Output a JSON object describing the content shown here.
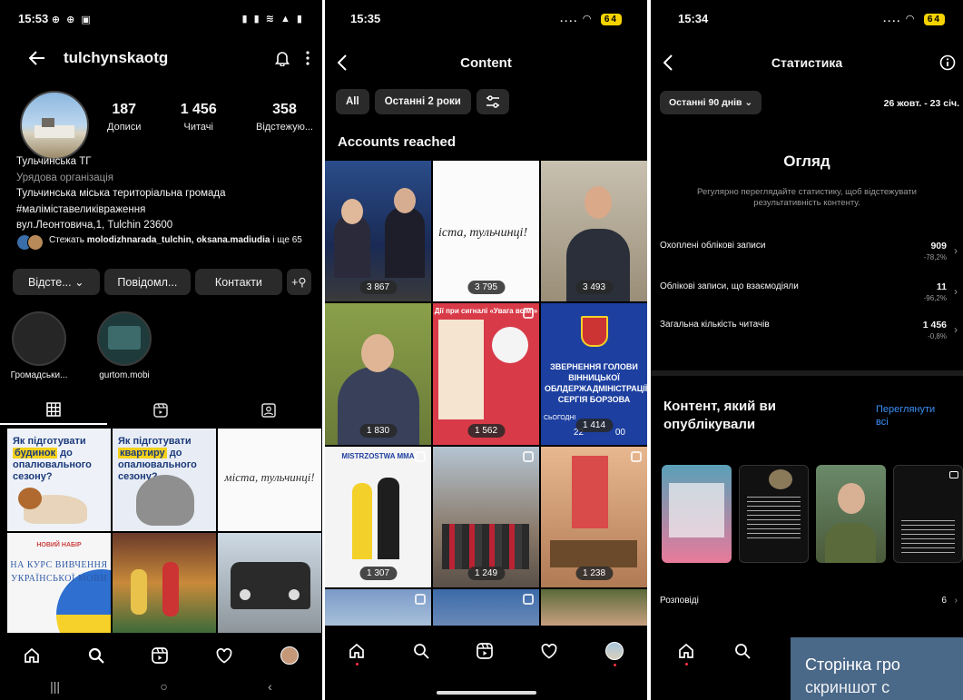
{
  "panel1": {
    "status_time": "15:53",
    "status_icons": "⊕ ⊕ ▣",
    "status_right": "▮ ▮ ≋ ▲ ▮",
    "username": "tulchynskaotg",
    "stats": [
      {
        "num": "187",
        "label": "Дописи"
      },
      {
        "num": "1 456",
        "label": "Читачі"
      },
      {
        "num": "358",
        "label": "Відстежую..."
      }
    ],
    "bio": {
      "name": "Тульчинська ТГ",
      "category": "Урядова організація",
      "line1": "Тульчинська міська територіальна громада",
      "line2": "#маліміставеликівраження",
      "line3": "вул.Леонтовича,1, Tulchin 23600"
    },
    "follow_prefix": "Стежать ",
    "follow_names": "molodizhnarada_tulchin, oksana.madiudia",
    "follow_suffix": " і ще 65",
    "buttons": {
      "follow": "Відсте... ⌄",
      "message": "Повідомл...",
      "contacts": "Контакти",
      "add": "+⚲"
    },
    "highlights": [
      {
        "label": "Громадськи..."
      },
      {
        "label": "gurtom.mobi"
      }
    ],
    "posts": {
      "p1_line1": "Як підготувати",
      "p1_hl": "будинок",
      "p1_line2": "до опалювального сезону?",
      "p2_line1": "Як підготувати",
      "p2_hl": "квартиру",
      "p2_line2": "до опалювального сезону?",
      "p3_text": "міста, тульчинці!",
      "p4_small": "НОВИЙ НАБІР",
      "p4_text": "НА КУРС ВИВЧЕННЯ УКРАЇНСЬКОЇ МОВИ"
    },
    "sysnav": {
      "recent": "|||",
      "home": "○",
      "back": "‹"
    }
  },
  "panel2": {
    "status_time": "15:35",
    "battery": "64",
    "title": "Content",
    "filters": {
      "all": "All",
      "period": "Останні 2 роки"
    },
    "section": "Accounts reached",
    "tiles": [
      {
        "count": "3 867"
      },
      {
        "count": "3 795",
        "text": "іста, тульчинці!"
      },
      {
        "count": "3 493"
      },
      {
        "count": "1 830"
      },
      {
        "count": "1 562",
        "text": "Дії при сигналі «Увага всім!»"
      },
      {
        "count": "1 414",
        "text": "ЗВЕРНЕННЯ ГОЛОВИ ВІННИЦЬКОЇ ОБЛДЕРЖАДМІНІСТРАЦІЇ СЕРГІЯ БОРЗОВА",
        "text2": "СЬОГОДНІ",
        "text3": "22",
        "text4": "00"
      },
      {
        "count": "1 307",
        "text": "MISTRZOSTWA MMA"
      },
      {
        "count": "1 249"
      },
      {
        "count": "1 238"
      }
    ]
  },
  "panel3": {
    "status_time": "15:34",
    "battery": "64",
    "title": "Статистика",
    "range": "Останні 90 днів ⌄",
    "dates": "26 жовт. - 23 січ.",
    "overview_title": "Огляд",
    "overview_desc": "Регулярно переглядайте статистику, щоб відстежувати результативність контенту.",
    "metrics": [
      {
        "label": "Охоплені облікові записи",
        "value": "909",
        "change": "-78,2%"
      },
      {
        "label": "Облікові записи, що взаємодіяли",
        "value": "11",
        "change": "-96,2%"
      },
      {
        "label": "Загальна кількість читачів",
        "value": "1 456",
        "change": "-0,8%"
      }
    ],
    "content_title": "Контент, який ви опублікували",
    "view_all": "Переглянути всі",
    "stories_label": "Розповіді",
    "stories_count": "6"
  },
  "caption": {
    "line1": "Сторінка гро",
    "line2": "скриншот с"
  },
  "colors": {
    "bg": "#000000",
    "chip": "#2a2a2a",
    "link": "#3a8ff7",
    "caption_bg": "#4a6888",
    "battery": "#f5d300"
  }
}
